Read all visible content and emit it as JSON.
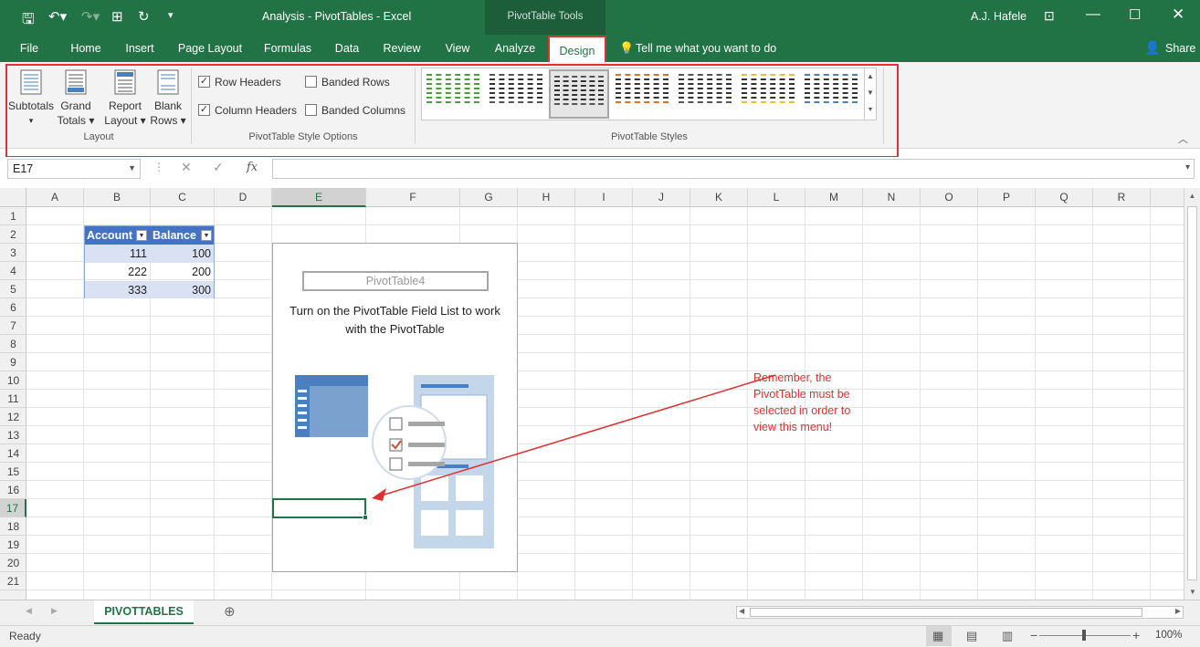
{
  "window": {
    "title": "Analysis - PivotTables  -  Excel",
    "context_tab": "PivotTable Tools",
    "user": "A.J. Hafele"
  },
  "tabs": [
    "File",
    "Home",
    "Insert",
    "Page Layout",
    "Formulas",
    "Data",
    "Review",
    "View",
    "Analyze",
    "Design"
  ],
  "tell_me": "Tell me what you want to do",
  "share": "Share",
  "ribbon": {
    "layout": {
      "label": "Layout",
      "buttons": [
        {
          "l1": "Subtotals",
          "l2": "▾"
        },
        {
          "l1": "Grand",
          "l2": "Totals ▾"
        },
        {
          "l1": "Report",
          "l2": "Layout ▾"
        },
        {
          "l1": "Blank",
          "l2": "Rows ▾"
        }
      ]
    },
    "style_options": {
      "label": "PivotTable Style Options",
      "checks": [
        {
          "label": "Row Headers",
          "checked": true
        },
        {
          "label": "Banded Rows",
          "checked": false
        },
        {
          "label": "Column Headers",
          "checked": true
        },
        {
          "label": "Banded Columns",
          "checked": false
        }
      ]
    },
    "styles": {
      "label": "PivotTable Styles",
      "swatch_colors": [
        "#4a9e3c",
        "#555555",
        "#555555",
        "#e07020",
        "#555555",
        "#e8c030",
        "#4a7fc0"
      ]
    }
  },
  "formula": {
    "name_box": "E17",
    "fx": "fx",
    "value": ""
  },
  "columns": [
    "A",
    "B",
    "C",
    "D",
    "E",
    "F",
    "G",
    "H",
    "I",
    "J",
    "K",
    "L",
    "M",
    "N",
    "O",
    "P",
    "Q",
    "R"
  ],
  "rows": [
    "1",
    "2",
    "3",
    "4",
    "5",
    "6",
    "7",
    "8",
    "9",
    "10",
    "11",
    "12",
    "13",
    "14",
    "15",
    "16",
    "17",
    "18",
    "19",
    "20",
    "21"
  ],
  "table": {
    "headers": [
      "Account",
      "Balance"
    ],
    "rows": [
      [
        "111",
        "100"
      ],
      [
        "222",
        "200"
      ],
      [
        "333",
        "300"
      ]
    ]
  },
  "pivot": {
    "name": "PivotTable4",
    "message_l1": "Turn on the PivotTable Field List to work",
    "message_l2": "with the PivotTable"
  },
  "annotation": {
    "lines": [
      "Remember, the",
      "PivotTable must be",
      "selected in order to",
      "view this menu!"
    ],
    "color": "#e03030"
  },
  "sheet_tab": "PIVOTTABLES",
  "status": {
    "left": "Ready",
    "zoom": "100%"
  },
  "accent": "#217346"
}
